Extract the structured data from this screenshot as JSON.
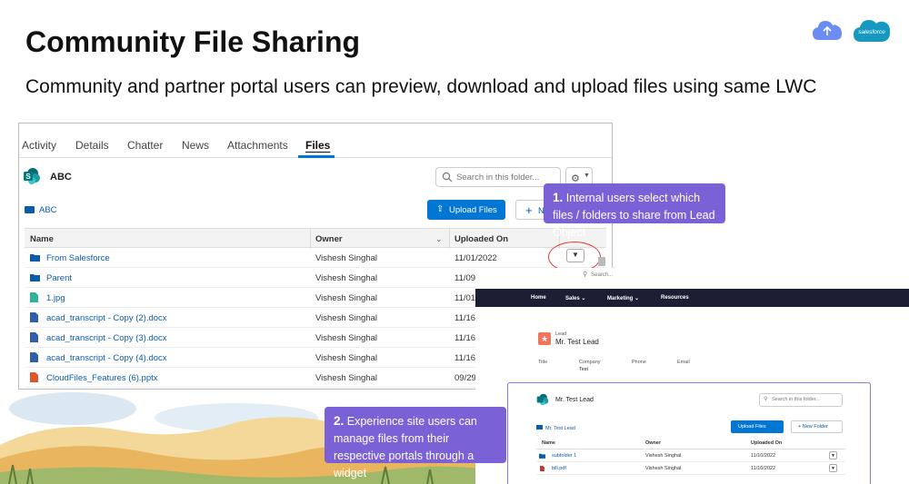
{
  "slide": {
    "title": "Community File Sharing",
    "subtitle": "Community and partner portal users can preview, download and upload files using same LWC",
    "logo_text": "salesforce"
  },
  "internal_panel": {
    "tabs": [
      {
        "label": "Activity"
      },
      {
        "label": "Details"
      },
      {
        "label": "Chatter"
      },
      {
        "label": "News"
      },
      {
        "label": "Attachments"
      },
      {
        "label": "Files",
        "active": true
      }
    ],
    "folder_title": "ABC",
    "search_placeholder": "Search in this folder...",
    "breadcrumb": "ABC",
    "upload_label": "Upload Files",
    "new_folder_label": "N",
    "columns": {
      "name": "Name",
      "owner": "Owner",
      "uploaded_on": "Uploaded On"
    },
    "rows": [
      {
        "name": "From Salesforce",
        "owner": "Vishesh Singhal",
        "date": "11/01/2022",
        "icon": "folder-icon"
      },
      {
        "name": "Parent",
        "owner": "Vishesh Singhal",
        "date": "11/09",
        "icon": "folder-icon"
      },
      {
        "name": "1.jpg",
        "owner": "Vishesh Singhal",
        "date": "11/01",
        "icon": "image-file-icon"
      },
      {
        "name": "acad_transcript - Copy (2).docx",
        "owner": "Vishesh Singhal",
        "date": "11/16",
        "icon": "word-file-icon"
      },
      {
        "name": "acad_transcript - Copy (3).docx",
        "owner": "Vishesh Singhal",
        "date": "11/16",
        "icon": "word-file-icon"
      },
      {
        "name": "acad_transcript - Copy (4).docx",
        "owner": "Vishesh Singhal",
        "date": "11/16",
        "icon": "word-file-icon"
      },
      {
        "name": "CloudFiles_Features (6).pptx",
        "owner": "Vishesh Singhal",
        "date": "09/29",
        "icon": "ppt-file-icon"
      }
    ]
  },
  "callouts": {
    "one_num": "1.",
    "one_text": " Internal users select which files / folders to share from Lead Object",
    "two_num": "2.",
    "two_text": " Experience site users can manage files from their respective portals through a widget"
  },
  "experience_panel": {
    "search_placeholder": "Search...",
    "nav": [
      "Home",
      "Sales ⌄",
      "Marketing ⌄",
      "Resources"
    ],
    "record_type": "Lead",
    "record_name": "Mr. Test Lead",
    "fields": [
      {
        "label": "Title",
        "value": ""
      },
      {
        "label": "Company",
        "value": "Test"
      },
      {
        "label": "Phone",
        "value": ""
      },
      {
        "label": "Email",
        "value": ""
      }
    ],
    "card_title": "Mr. Test Lead",
    "card_search_placeholder": "Search in this folder...",
    "breadcrumb": "Mr. Test Lead",
    "upload_label": "Upload Files",
    "new_folder_label": "+ New Folder",
    "columns": {
      "name": "Name",
      "owner": "Owner",
      "uploaded_on": "Uploaded On"
    },
    "rows": [
      {
        "name": "subfolder 1",
        "owner": "Vishesh Singhal",
        "date": "11/10/2022",
        "icon": "folder-icon"
      },
      {
        "name": "bill.pdf",
        "owner": "Vishesh Singhal",
        "date": "11/10/2022",
        "icon": "pdf-file-icon"
      }
    ]
  }
}
